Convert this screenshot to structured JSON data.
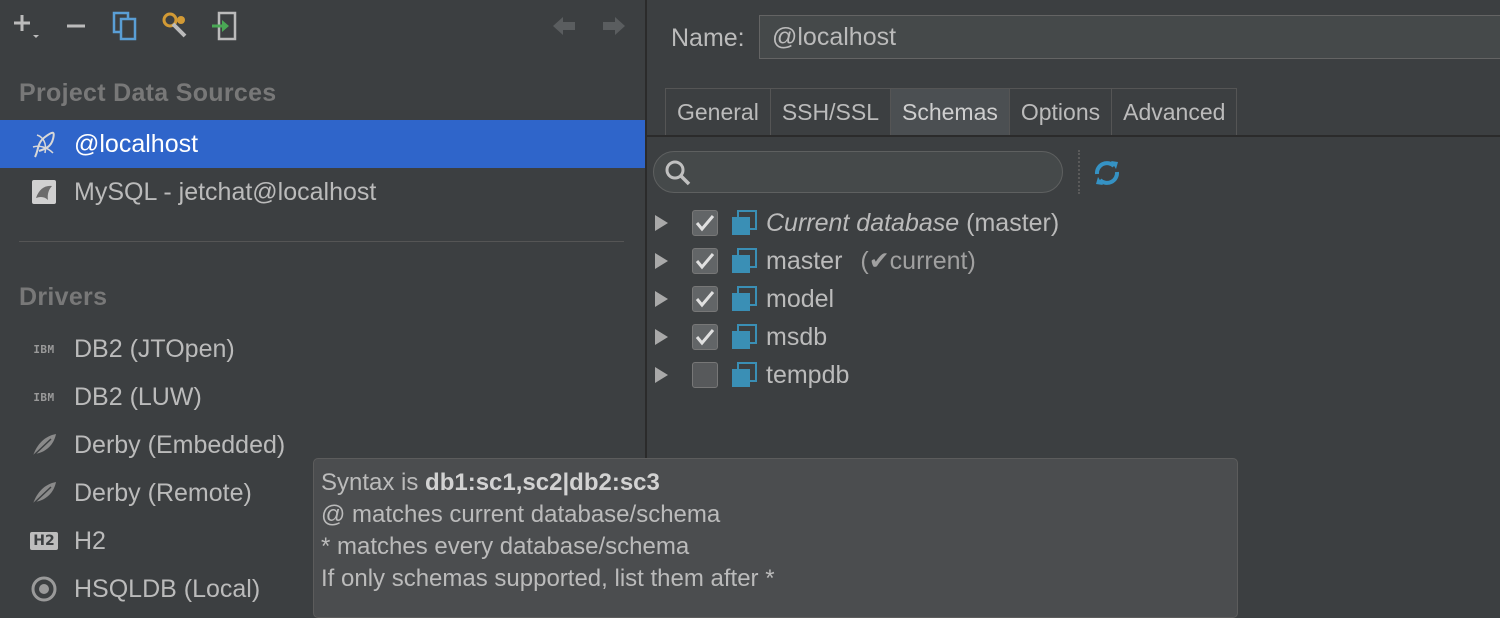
{
  "toolbar": {
    "buttons": [
      "add-icon",
      "remove-icon",
      "duplicate-icon",
      "driver-settings-icon",
      "import-icon",
      "back-icon",
      "forward-icon"
    ]
  },
  "sidebar": {
    "project_title": "Project Data Sources",
    "data_sources": [
      {
        "label": "@localhost",
        "icon": "mssql-icon",
        "selected": true
      },
      {
        "label": "MySQL - jetchat@localhost",
        "icon": "mysql-icon",
        "selected": false
      }
    ],
    "drivers_title": "Drivers",
    "drivers": [
      {
        "label": "DB2 (JTOpen)",
        "icon": "ibm-icon",
        "icon_text": "IBM"
      },
      {
        "label": "DB2 (LUW)",
        "icon": "ibm-icon",
        "icon_text": "IBM"
      },
      {
        "label": "Derby (Embedded)",
        "icon": "derby-icon"
      },
      {
        "label": "Derby (Remote)",
        "icon": "derby-icon"
      },
      {
        "label": "H2",
        "icon": "h2-icon",
        "icon_text": "H2"
      },
      {
        "label": "HSQLDB (Local)",
        "icon": "hsqldb-icon"
      }
    ]
  },
  "form": {
    "name_label": "Name:",
    "name_value": "@localhost"
  },
  "tabs": [
    {
      "label": "General",
      "active": false
    },
    {
      "label": "SSH/SSL",
      "active": false
    },
    {
      "label": "Schemas",
      "active": true
    },
    {
      "label": "Options",
      "active": false
    },
    {
      "label": "Advanced",
      "active": false
    }
  ],
  "schemas": {
    "search_value": "",
    "rows": [
      {
        "name": "Current database",
        "suffix": "(master)",
        "checked": true,
        "italic": true
      },
      {
        "name": "master",
        "suffix": "(✔current)",
        "checked": true,
        "italic": false
      },
      {
        "name": "model",
        "suffix": "",
        "checked": true,
        "italic": false
      },
      {
        "name": "msdb",
        "suffix": "",
        "checked": true,
        "italic": false
      },
      {
        "name": "tempdb",
        "suffix": "",
        "checked": false,
        "italic": false
      }
    ]
  },
  "tooltip": {
    "line1_prefix": "Syntax is ",
    "line1_bold": "db1:sc1,sc2|db2:sc3",
    "line2": "@ matches current database/schema",
    "line3": "* matches every database/schema",
    "line4": "If only schemas supported, list them after *"
  },
  "colors": {
    "background": "#3c3f41",
    "selection": "#2f65ca",
    "accent_blue": "#3592c4"
  }
}
